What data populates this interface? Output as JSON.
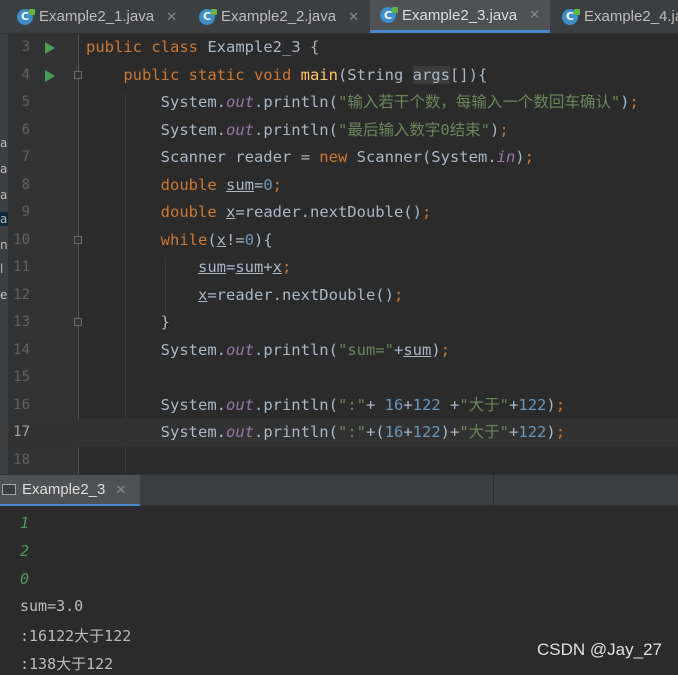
{
  "tabs": [
    {
      "label": "Example2_1.java",
      "active": false
    },
    {
      "label": "Example2_2.java",
      "active": false
    },
    {
      "label": "Example2_3.java",
      "active": true
    },
    {
      "label": "Example2_4.ja",
      "active": false
    }
  ],
  "tab_close_glyph": "✕",
  "left_strip_chars": [
    "a",
    "a",
    "a",
    "a",
    "n",
    "l",
    "e"
  ],
  "editor": {
    "current_line": "17",
    "lines": [
      {
        "num": "3",
        "code": "public class Example2_3 {"
      },
      {
        "num": "4",
        "code": "    public static void main(String args[]){"
      },
      {
        "num": "5",
        "code": "        System.out.println(\"输入若干个数，每输入一个数回车确认\");"
      },
      {
        "num": "6",
        "code": "        System.out.println(\"最后输入数字0结束\");"
      },
      {
        "num": "7",
        "code": "        Scanner reader = new Scanner(System.in);"
      },
      {
        "num": "8",
        "code": "        double sum=0;"
      },
      {
        "num": "9",
        "code": "        double x=reader.nextDouble();"
      },
      {
        "num": "10",
        "code": "        while(x!=0){"
      },
      {
        "num": "11",
        "code": "            sum=sum+x;"
      },
      {
        "num": "12",
        "code": "            x=reader.nextDouble();"
      },
      {
        "num": "13",
        "code": "        }"
      },
      {
        "num": "14",
        "code": "        System.out.println(\"sum=\"+sum);"
      },
      {
        "num": "15",
        "code": ""
      },
      {
        "num": "16",
        "code": "        System.out.println(\":\"+ 16+122 +\"大于\"+122);"
      },
      {
        "num": "17",
        "code": "        System.out.println(\":\"+(16+122)+\"大于\"+122);"
      },
      {
        "num": "18",
        "code": ""
      }
    ]
  },
  "run_tab": {
    "label": "Example2_3"
  },
  "console": {
    "inputs": [
      "1",
      "2",
      "0"
    ],
    "outputs": [
      "sum=3.0",
      ":16122大于122",
      ":138大于122"
    ]
  },
  "watermark": "CSDN @Jay_27",
  "colors": {
    "keyword": "#cc7832",
    "method": "#ffc66d",
    "static_field": "#9876aa",
    "string": "#6a8759",
    "number": "#6897bb",
    "default_text": "#a9b7c6",
    "console_input": "#499c54"
  }
}
